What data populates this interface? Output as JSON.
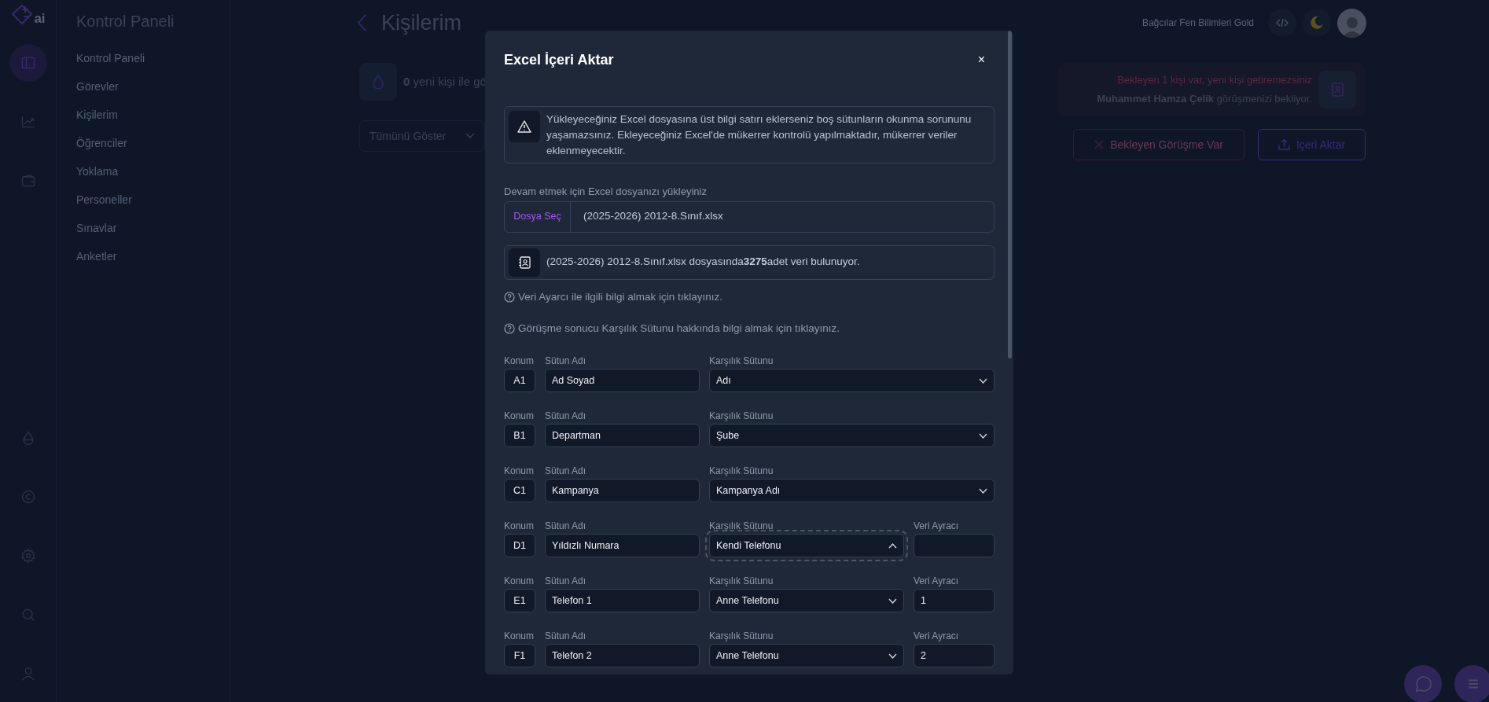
{
  "rail": {
    "logo_text": "ai",
    "items": [
      {
        "selected": true
      },
      {
        "selected": false
      },
      {
        "selected": false
      }
    ]
  },
  "sidebar": {
    "title": "Kontrol Paneli",
    "items": [
      "Kontrol Paneli",
      "Görevler",
      "Kişilerim",
      "Öğrenciler",
      "Yoklama",
      "Personeller",
      "Sınavlar",
      "Anketler"
    ]
  },
  "header": {
    "title": "Kişilerim",
    "organization": "Bağcılar Fen Bilimleri Gold"
  },
  "stat": {
    "text": "**0** yeni kişi ile gö"
  },
  "filter": {
    "value": "Tümünü Göster"
  },
  "pending": {
    "message": "Bekleyen 1 kişi var, yeni kişi getiremezsiniz",
    "detail": "**Muhammet Hamza Çelik** görüşmenizi bekliyor."
  },
  "actions": [
    {
      "label": "Bekleyen Görüşme Var",
      "kind": "danger"
    },
    {
      "label": "İçeri Aktar",
      "kind": "primary"
    }
  ],
  "modal": {
    "title": "Excel İçeri Aktar",
    "close": "×",
    "warning": "Yükleyeceğiniz Excel dosyasına üst bilgi satırı eklerseniz boş sütunların okunma sorununu yaşamazsınız. Ekleyeceğiniz Excel'de mükerrer kontrolü yapılmaktadır, mükerrer veriler eklenmeyecektir.",
    "upload_label": "Devam etmek için Excel dosyanızı yükleyiniz",
    "file_button": "Dosya Seç",
    "file_name": "(2025-2026) 2012-8.Sınıf.xlsx",
    "info": "(2025-2026) 2012-8.Sınıf.xlsx dosyasında**3275**adet veri bulunuyor.",
    "help_links": [
      "Veri Ayarcı ile ilgili bilgi almak için tıklayınız.",
      "Görüşme sonucu Karşılık Sütunu hakkında bilgi almak için tıklayınız."
    ],
    "rows": [
      {
        "kind": "basic",
        "position_label": "Konum",
        "position": "A1",
        "name_label": "Sütun Adı",
        "name": "Ad Soyad",
        "match_label": "Karşılık Sütunu",
        "match": "Adı",
        "expanded": false
      },
      {
        "kind": "basic",
        "position_label": "Konum",
        "position": "B1",
        "name_label": "Sütun Adı",
        "name": "Departman",
        "match_label": "Karşılık Sütunu",
        "match": "Şube",
        "expanded": false
      },
      {
        "kind": "basic",
        "position_label": "Konum",
        "position": "C1",
        "name_label": "Sütun Adı",
        "name": "Kampanya",
        "match_label": "Karşılık Sütunu",
        "match": "Kampanya Adı",
        "expanded": false
      },
      {
        "kind": "separated",
        "position_label": "Konum",
        "position": "D1",
        "name_label": "Sütun Adı",
        "name": "Yıldızlı Numara",
        "match_label": "Karşılık Sütunu",
        "match": "Kendi Telefonu",
        "expanded": true,
        "separator_label": "Veri Ayracı"
      },
      {
        "kind": "separated",
        "position_label": "Konum",
        "position": "E1",
        "name_label": "Sütun Adı",
        "name": "Telefon 1",
        "match_label": "Karşılık Sütunu",
        "match": "Anne Telefonu",
        "expanded": false,
        "separator_label": "Veri Ayracı",
        "separator": "1"
      },
      {
        "kind": "separated",
        "position_label": "Konum",
        "position": "F1",
        "name_label": "Sütun Adı",
        "name": "Telefon 2",
        "match_label": "Karşılık Sütunu",
        "match": "Anne Telefonu",
        "expanded": false,
        "separator_label": "Veri Ayracı",
        "separator": "2"
      }
    ]
  }
}
